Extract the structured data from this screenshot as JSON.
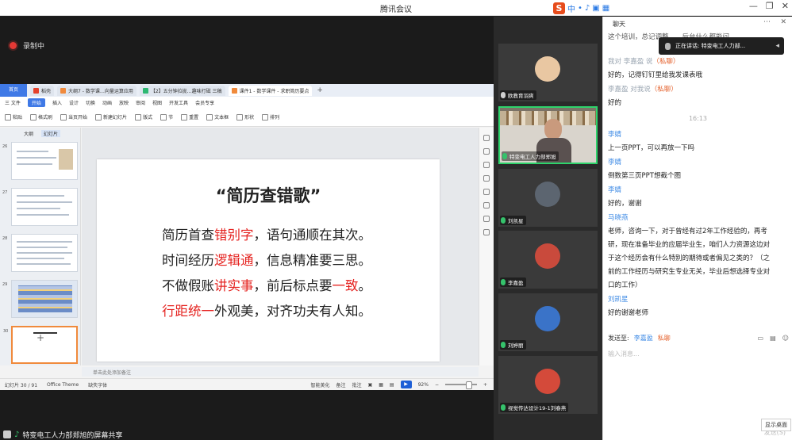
{
  "titlebar": {
    "title": "腾讯会议",
    "ime": {
      "logo": "S",
      "lang": "中"
    }
  },
  "stage": {
    "recording": "录制中"
  },
  "wps": {
    "home_tab": "首页",
    "tabs": [
      {
        "label": "稻壳",
        "color": "#e5412b",
        "active": false
      },
      {
        "label": "大纲7 - 数学课…向量运算应用",
        "color": "#f08a3c",
        "active": false
      },
      {
        "label": "【2】五分钟拉拢…趣味打磁 三稿",
        "color": "#2eb872",
        "active": false
      },
      {
        "label": "课件1 - 数学课件 - 求职简历要点",
        "color": "#f08a3c",
        "active": true
      }
    ],
    "menu": [
      "三 文件",
      "开始",
      "插入",
      "设计",
      "切换",
      "动画",
      "放映",
      "审阅",
      "视图",
      "开发工具",
      "会员专享"
    ],
    "menu_active": "开始",
    "toolbar": [
      "粘贴",
      "格式刷",
      "当页开始",
      "新建幻灯片",
      "版式",
      "节",
      "重置",
      "文本框",
      "形状",
      "排列"
    ],
    "sidebar_tabs": [
      "大纲",
      "幻灯片"
    ],
    "slide_numbers": [
      "26",
      "27",
      "28",
      "29",
      "30"
    ],
    "slide": {
      "title": "“简历查错歌”",
      "lines": [
        [
          {
            "t": "简历首查",
            "red": false
          },
          {
            "t": "错别字",
            "red": true
          },
          {
            "t": "，语句通顺在其次。",
            "red": false
          }
        ],
        [
          {
            "t": "时间经历",
            "red": false
          },
          {
            "t": "逻辑通",
            "red": true
          },
          {
            "t": "，信息精准要三思。",
            "red": false
          }
        ],
        [
          {
            "t": "不做假账",
            "red": false
          },
          {
            "t": "讲实事",
            "red": true
          },
          {
            "t": "，前后标点要",
            "red": false
          },
          {
            "t": "一致",
            "red": true
          },
          {
            "t": "。",
            "red": false
          }
        ],
        [
          {
            "t": "行距统一",
            "red": true
          },
          {
            "t": "外观美，对齐功夫有人知。",
            "red": false
          }
        ]
      ]
    },
    "notes_placeholder": "单击此处添加备注",
    "status": {
      "slide_count": "幻灯片 30 / 91",
      "theme": "Office Theme",
      "font_missing": "缺失字体",
      "smart_beautify": "智能美化",
      "notes": "备注",
      "comment": "批注",
      "zoom": "92%"
    }
  },
  "sharebar": {
    "text": "特变电工人力部郑旭的屏幕共享"
  },
  "participants": [
    {
      "name": "欧教育羽爽",
      "kind": "avatar",
      "avatar": "#e9c7a2",
      "mic": "none"
    },
    {
      "name": "特变电工人力部郑旭",
      "kind": "video",
      "mic": "on"
    },
    {
      "name": "刘凯星",
      "kind": "avatar",
      "avatar": "#5c6570",
      "mic": "on"
    },
    {
      "name": "李嘉盈",
      "kind": "avatar",
      "avatar": "#c94a3c",
      "mic": "on"
    },
    {
      "name": "刘婷丽",
      "kind": "avatar",
      "avatar": "#3a73c8",
      "mic": "on"
    },
    {
      "name": "视觉传达设计19-1刘春燕",
      "kind": "avatar",
      "avatar": "#d44a3a",
      "mic": "on"
    }
  ],
  "chat": {
    "header": "聊天",
    "speaking": "正在讲话: 特变电工人力部...",
    "partial_top": "这个培训，总记调整，…后台什么都能问",
    "messages": [
      {
        "meta_name": "我对 李嘉盈 说",
        "meta_private": "（私聊）",
        "text": [
          "好的，记得钉钉里给我发课表哦"
        ]
      },
      {
        "meta_name": "李嘉盈 对我说",
        "meta_private": "（私聊）",
        "text": [
          "好的"
        ]
      },
      {
        "time": "16:13"
      },
      {
        "meta_name": "李婧",
        "text": [
          "上一页PPT，可以再放一下吗"
        ]
      },
      {
        "meta_name": "李婧",
        "text": [
          "倒数第三页PPT想截个图"
        ]
      },
      {
        "meta_name": "李婧",
        "text": [
          "好的，谢谢"
        ]
      },
      {
        "meta_name": "马晓燕",
        "text": [
          "老师，咨询一下，对于曾经有过2年工作经验的，再考",
          "研，现在准备毕业的应届毕业生，咱们人力资源这边对",
          "于这个经历会有什么特别的期待或者偏见之类的？（之",
          "前的工作经历与研究生专业无关，毕业后想选择专业对",
          "口的工作）"
        ]
      },
      {
        "meta_name": "刘凯星",
        "text": [
          "好的谢谢老师"
        ]
      }
    ],
    "send_label": "发送至:",
    "send_to": "李嘉盈",
    "send_private": "私聊",
    "input_placeholder": "输入消息...",
    "send_button": "发送(S)",
    "show_desktop": "显示桌面"
  }
}
